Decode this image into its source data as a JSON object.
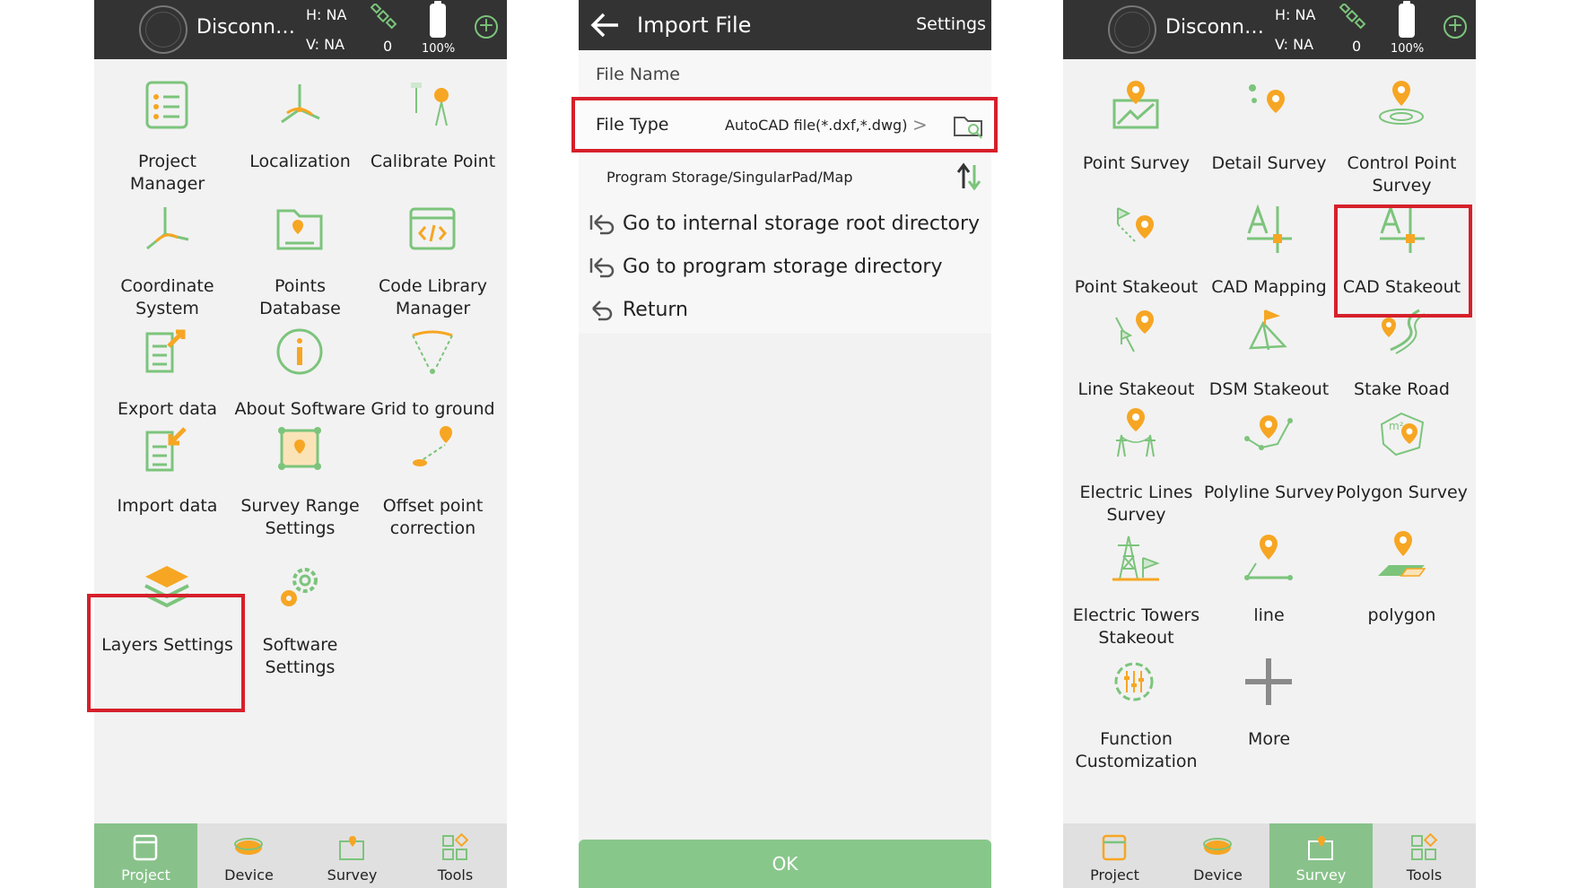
{
  "status": {
    "connection": "Disconn…",
    "h_label": "H: NA",
    "v_label": "V: NA",
    "satellites": "0",
    "battery": "100%"
  },
  "colors": {
    "accent_green": "#88c28a",
    "icon_orange": "#f6a623",
    "icon_green": "#7cc47c",
    "highlight_red": "#d6202b",
    "dark_bar": "#333333"
  },
  "project_screen": {
    "tiles": [
      {
        "label": "Project\nManager",
        "icon": "clipboard-list-icon"
      },
      {
        "label": "Localization",
        "icon": "localization-axes-icon"
      },
      {
        "label": "Calibrate Point",
        "icon": "calibrate-tripod-icon"
      },
      {
        "label": "Coordinate\nSystem",
        "icon": "coordinate-axes-icon"
      },
      {
        "label": "Points Database",
        "icon": "folder-pin-icon"
      },
      {
        "label": "Code Library\nManager",
        "icon": "code-window-icon"
      },
      {
        "label": "Export data",
        "icon": "export-doc-icon"
      },
      {
        "label": "About Software",
        "icon": "info-circle-icon"
      },
      {
        "label": "Grid to ground",
        "icon": "grid-ground-icon"
      },
      {
        "label": "Import data",
        "icon": "import-doc-icon"
      },
      {
        "label": "Survey Range\nSettings",
        "icon": "survey-range-icon"
      },
      {
        "label": "Offset point\ncorrection",
        "icon": "offset-point-icon"
      },
      {
        "label": "Layers Settings",
        "icon": "layers-icon"
      },
      {
        "label": "Software\nSettings",
        "icon": "gears-icon"
      }
    ],
    "nav": [
      {
        "label": "Project",
        "icon": "project-tab-icon",
        "active": true
      },
      {
        "label": "Device",
        "icon": "device-tab-icon",
        "active": false
      },
      {
        "label": "Survey",
        "icon": "survey-tab-icon",
        "active": false
      },
      {
        "label": "Tools",
        "icon": "tools-tab-icon",
        "active": false
      }
    ]
  },
  "import_screen": {
    "title": "Import File",
    "settings_label": "Settings",
    "file_name_label": "File Name",
    "file_type_label": "File Type",
    "file_type_value": "AutoCAD file(*.dxf,*.dwg)",
    "path": "Program Storage/SingularPad/Map",
    "nav_items": [
      "Go to internal storage root directory",
      "Go to program storage directory",
      "Return"
    ],
    "ok_label": "OK"
  },
  "survey_screen": {
    "tiles": [
      {
        "label": "Point Survey",
        "icon": "point-survey-icon"
      },
      {
        "label": "Detail Survey",
        "icon": "detail-survey-icon"
      },
      {
        "label": "Control Point\nSurvey",
        "icon": "control-point-icon"
      },
      {
        "label": "Point Stakeout",
        "icon": "point-stakeout-icon"
      },
      {
        "label": "CAD Mapping",
        "icon": "cad-mapping-icon"
      },
      {
        "label": "CAD Stakeout",
        "icon": "cad-stakeout-icon"
      },
      {
        "label": "Line Stakeout",
        "icon": "line-stakeout-icon"
      },
      {
        "label": "DSM Stakeout",
        "icon": "dsm-stakeout-icon"
      },
      {
        "label": "Stake Road",
        "icon": "stake-road-icon"
      },
      {
        "label": "Electric Lines\nSurvey",
        "icon": "electric-lines-icon"
      },
      {
        "label": "Polyline Survey",
        "icon": "polyline-survey-icon"
      },
      {
        "label": "Polygon Survey",
        "icon": "polygon-survey-icon"
      },
      {
        "label": "Electric Towers\nStakeout",
        "icon": "electric-tower-icon"
      },
      {
        "label": "line",
        "icon": "line-icon"
      },
      {
        "label": "polygon",
        "icon": "polygon-icon"
      },
      {
        "label": "Function\nCustomization",
        "icon": "function-gear-icon"
      },
      {
        "label": "More",
        "icon": "plus-icon"
      }
    ],
    "nav": [
      {
        "label": "Project",
        "icon": "project-tab-icon",
        "active": false
      },
      {
        "label": "Device",
        "icon": "device-tab-icon",
        "active": false
      },
      {
        "label": "Survey",
        "icon": "survey-tab-icon",
        "active": true
      },
      {
        "label": "Tools",
        "icon": "tools-tab-icon",
        "active": false
      }
    ]
  }
}
